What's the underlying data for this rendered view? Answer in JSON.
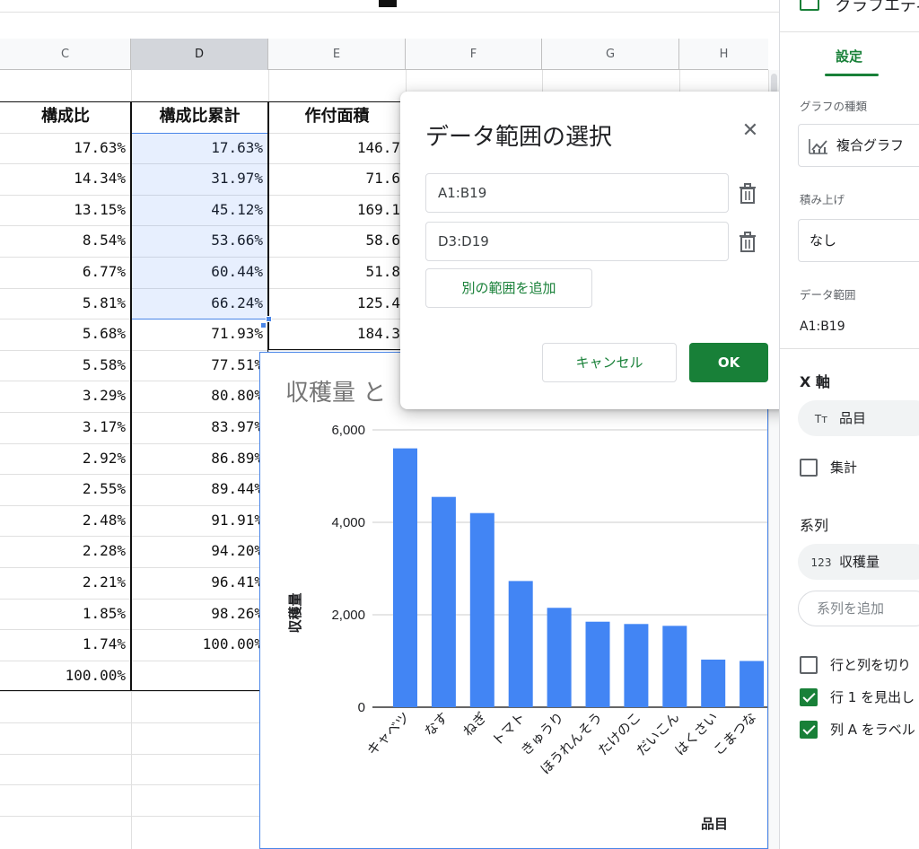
{
  "columns": [
    "C",
    "D",
    "E",
    "F",
    "G",
    "H"
  ],
  "table": {
    "headers": [
      "構成比",
      "構成比累計",
      "作付面積"
    ],
    "ratio": [
      "17.63%",
      "14.34%",
      "13.15%",
      "8.54%",
      "6.77%",
      "5.81%",
      "5.68%",
      "5.58%",
      "3.29%",
      "3.17%",
      "2.92%",
      "2.55%",
      "2.48%",
      "2.28%",
      "2.21%",
      "1.85%",
      "1.74%",
      "100.00%"
    ],
    "cumulative": [
      "17.63%",
      "31.97%",
      "45.12%",
      "53.66%",
      "60.44%",
      "66.24%",
      "71.93%",
      "77.51%",
      "80.80%",
      "83.97%",
      "86.89%",
      "89.44%",
      "91.91%",
      "94.20%",
      "96.41%",
      "98.26%",
      "100.00%"
    ],
    "area": [
      "146.7",
      "71.6",
      "169.1",
      "58.6",
      "51.8",
      "125.4",
      "184.3"
    ]
  },
  "dialog": {
    "title": "データ範囲の選択",
    "close_icon": "close-icon",
    "ranges": [
      "A1:B19",
      "D3:D19"
    ],
    "add_range_label": "別の範囲を追加",
    "cancel_label": "キャンセル",
    "ok_label": "OK"
  },
  "chart_data": {
    "type": "bar",
    "title": "収穫量 と",
    "xlabel": "品目",
    "ylabel": "収穫量",
    "ylim": [
      0,
      6000
    ],
    "yticks": [
      "0",
      "2,000",
      "4,000",
      "6,000"
    ],
    "categories": [
      "キャベツ",
      "なす",
      "ねぎ",
      "トマト",
      "きゅうり",
      "ほうれんそう",
      "たけのこ",
      "だいこん",
      "はくさい",
      "こまつな"
    ],
    "values": [
      5600,
      4550,
      4200,
      2730,
      2150,
      1850,
      1800,
      1760,
      1030,
      1000
    ],
    "color": "#4285f4",
    "grid": true
  },
  "panel": {
    "header_title": "グラフエディ",
    "tab_settings": "設定",
    "chart_type_label": "グラフの種類",
    "chart_type_value": "複合グラフ",
    "stack_label": "積み上げ",
    "stack_value": "なし",
    "data_range_label": "データ範囲",
    "data_range_value": "A1:B19",
    "x_axis_label": "X 軸",
    "x_axis_chip": "品目",
    "aggregate_label": "集計",
    "series_label": "系列",
    "series_chip_icon": "123",
    "series_chip": "収穫量",
    "add_series": "系列を追加",
    "switch_rows_cols": "行と列を切り",
    "row1_header": "行 1 を見出し",
    "colA_labels": "列 A をラベル",
    "accent_color": "#188038"
  }
}
